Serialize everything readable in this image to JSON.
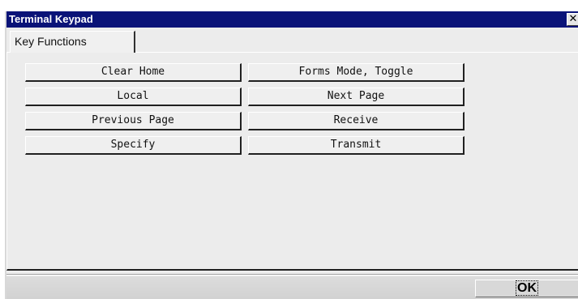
{
  "window": {
    "title": "Terminal Keypad",
    "close_glyph": "✕"
  },
  "tab": {
    "label": "Key Functions"
  },
  "keys": [
    {
      "label": "Clear Home"
    },
    {
      "label": "Forms Mode, Toggle"
    },
    {
      "label": "Local"
    },
    {
      "label": "Next Page"
    },
    {
      "label": "Previous Page"
    },
    {
      "label": "Receive"
    },
    {
      "label": "Specify"
    },
    {
      "label": "Transmit"
    }
  ],
  "footer": {
    "ok_label": "OK"
  },
  "colors": {
    "titlebar": "#0a1378",
    "panel": "#ececec"
  }
}
